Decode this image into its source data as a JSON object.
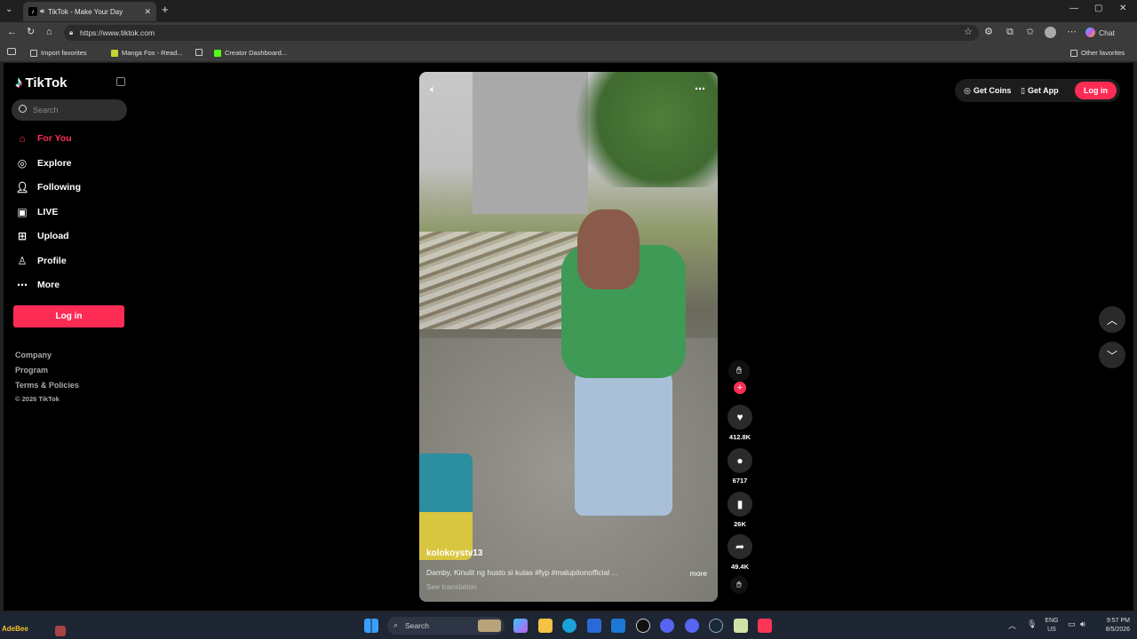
{
  "browser": {
    "tab_title": "TikTok - Make Your Day",
    "new_tab": "+",
    "url": "https://www.tiktok.com",
    "chat_label": "Chat",
    "favorites": [
      {
        "label": "Import favorites"
      },
      {
        "label": "Manga Fox - Read..."
      },
      {
        "label": "Creator Dashboard..."
      }
    ],
    "other_favorites": "Other favorites"
  },
  "sidebar": {
    "logo_text": "TikTok",
    "search_placeholder": "Search",
    "nav": [
      {
        "label": "For You",
        "icon": "home-icon",
        "active": true
      },
      {
        "label": "Explore",
        "icon": "compass-icon"
      },
      {
        "label": "Following",
        "icon": "following-icon"
      },
      {
        "label": "LIVE",
        "icon": "live-icon"
      },
      {
        "label": "Upload",
        "icon": "upload-icon"
      },
      {
        "label": "Profile",
        "icon": "profile-icon"
      },
      {
        "label": "More",
        "icon": "more-icon"
      }
    ],
    "login_label": "Log in",
    "footer": {
      "company": "Company",
      "program": "Program",
      "terms": "Terms & Policies",
      "copyright": "© 2026 TikTok"
    }
  },
  "topbar": {
    "get_coins": "Get Coins",
    "get_app": "Get App",
    "login": "Log in"
  },
  "video": {
    "username": "kolokoystv13",
    "caption": "Damby, Kinulit ng husto si kulas #fyp #malupitonofficial ...",
    "more": "more",
    "see_translation": "See translation"
  },
  "actions": {
    "likes": "412.8K",
    "comments": "6717",
    "saves": "26K",
    "shares": "49.4K"
  },
  "taskbar": {
    "search_placeholder": "Search",
    "left_label": "AdeBee",
    "lang_top": "ENG",
    "lang_bottom": "US",
    "time": "9:57 PM",
    "date": "8/5/2026"
  },
  "colors": {
    "accent": "#fe2c55",
    "page_bg": "#000000"
  }
}
